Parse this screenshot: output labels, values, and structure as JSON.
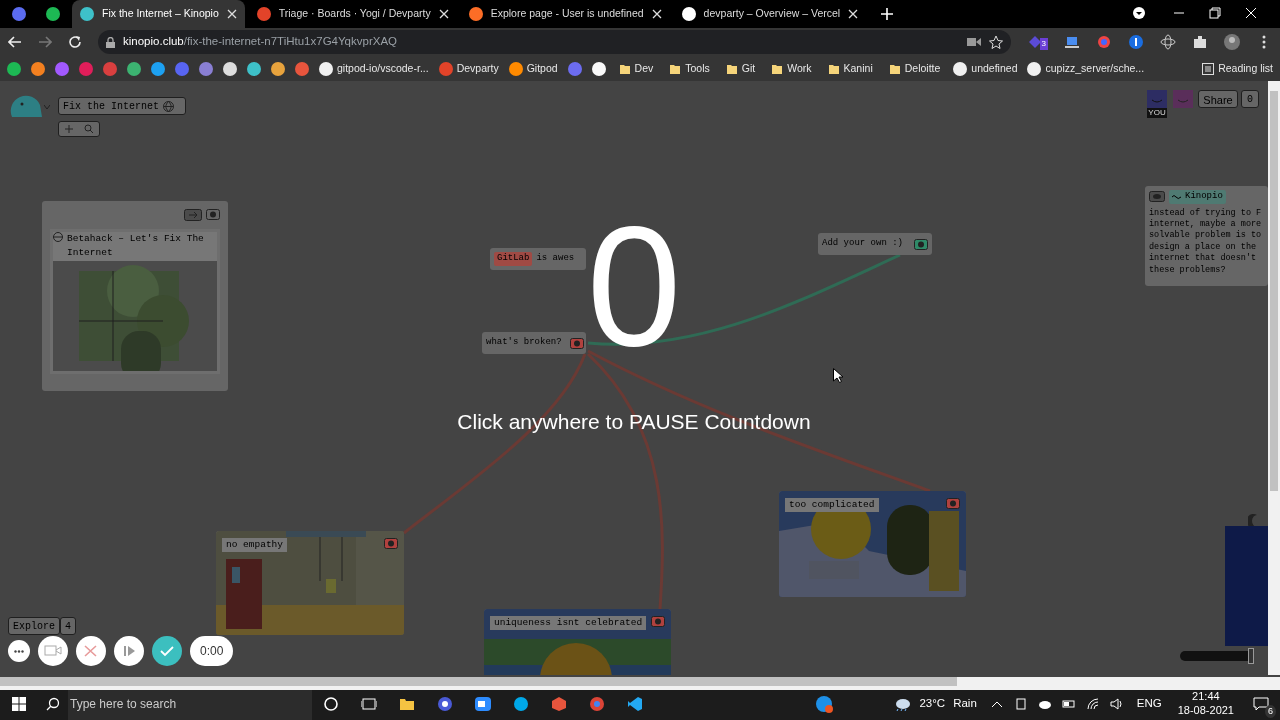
{
  "tabs": [
    {
      "kind": "pinned",
      "color": "#5b6cf0",
      "selected": false
    },
    {
      "kind": "pinned",
      "color": "#1db954",
      "selected": false
    },
    {
      "kind": "page",
      "title": "Fix the Internet – Kinopio",
      "color": "#3ec1c9",
      "selected": true
    },
    {
      "kind": "page",
      "title": "Triage · Boards · Yogi / Devparty",
      "color": "#e24329",
      "selected": false
    },
    {
      "kind": "page",
      "title": "Explore page - User is undefined",
      "color": "#fc6d26",
      "selected": false
    },
    {
      "kind": "page",
      "title": "devparty – Overview – Vercel",
      "color": "#ffffff",
      "selected": false
    }
  ],
  "address": {
    "domain": "kinopio.club",
    "path": "/fix-the-internet-n7TiHtu1x7G4YqkvprXAQ"
  },
  "extension_badge": "3",
  "bookmarks": [
    {
      "kind": "icon",
      "color": "#1db954"
    },
    {
      "kind": "icon",
      "color": "#f38020"
    },
    {
      "kind": "icon",
      "color": "#a259ff"
    },
    {
      "kind": "icon",
      "color": "#e01e5a"
    },
    {
      "kind": "icon",
      "color": "#d93f3f"
    },
    {
      "kind": "icon",
      "color": "#3cb371"
    },
    {
      "kind": "icon",
      "color": "#1da1f2"
    },
    {
      "kind": "icon",
      "color": "#5865f2"
    },
    {
      "kind": "icon",
      "color": "#8a7fd4"
    },
    {
      "kind": "icon",
      "color": "#dddddd"
    },
    {
      "kind": "icon",
      "color": "#3ec1c9"
    },
    {
      "kind": "icon",
      "color": "#e8a33d"
    },
    {
      "kind": "icon",
      "color": "#e8553d"
    },
    {
      "kind": "site",
      "label": "gitpod-io/vscode-r...",
      "color": "#f0f0f0"
    },
    {
      "kind": "site",
      "label": "Devparty",
      "color": "#e24329"
    },
    {
      "kind": "site",
      "label": "Gitpod",
      "color": "#ff8a00"
    },
    {
      "kind": "icon",
      "color": "#6c6cf0"
    },
    {
      "kind": "icon",
      "color": "#fafafa"
    },
    {
      "kind": "folder",
      "label": "Dev"
    },
    {
      "kind": "folder",
      "label": "Tools"
    },
    {
      "kind": "folder",
      "label": "Git"
    },
    {
      "kind": "folder",
      "label": "Work"
    },
    {
      "kind": "folder",
      "label": "Kanini"
    },
    {
      "kind": "folder",
      "label": "Deloitte"
    },
    {
      "kind": "site",
      "label": "undefined",
      "color": "#f0f0f0"
    },
    {
      "kind": "site",
      "label": "cupizz_server/sche...",
      "color": "#f0f0f0"
    }
  ],
  "reading_list": "Reading list",
  "space": {
    "name": "Fix the Internet"
  },
  "users": {
    "you": "YOU",
    "share": "Share",
    "count": "0"
  },
  "cards": [
    {
      "kind": "link",
      "text": "Betahack – Let's Fix The Internet"
    },
    {
      "kind": "tagged",
      "tag": "GitLab",
      "text": "is awes"
    },
    {
      "kind": "text",
      "text": "what's broken?",
      "color": "#b0413e"
    },
    {
      "kind": "text",
      "text": "Add your own :)",
      "color": "#2f8a68"
    },
    {
      "kind": "note",
      "tag": "Kinopio",
      "text": "instead of trying to F\ninternet, maybe a more\nsolvable problem is to\ndesign a place on the\ninternet that doesn't\nthese problems?"
    },
    {
      "text": "no empathy",
      "color": "#b0413e"
    },
    {
      "text": "too complicated",
      "color": "#b0413e"
    },
    {
      "text": "uniqueness isnt celebrated",
      "color": "#b0413e"
    }
  ],
  "explore": {
    "label": "Explore",
    "count": "4"
  },
  "countdown": {
    "count": "0",
    "hint": "Click anywhere to PAUSE Countdown"
  },
  "recorder": {
    "timer": "0:00"
  },
  "zoom_slider": {
    "level": 1
  },
  "taskbar": {
    "search_placeholder": "Type here to search",
    "temperature": "23°C",
    "weather": "Rain",
    "language": "ENG",
    "time": "21:44",
    "date": "18-08-2021",
    "notifications": "6"
  }
}
